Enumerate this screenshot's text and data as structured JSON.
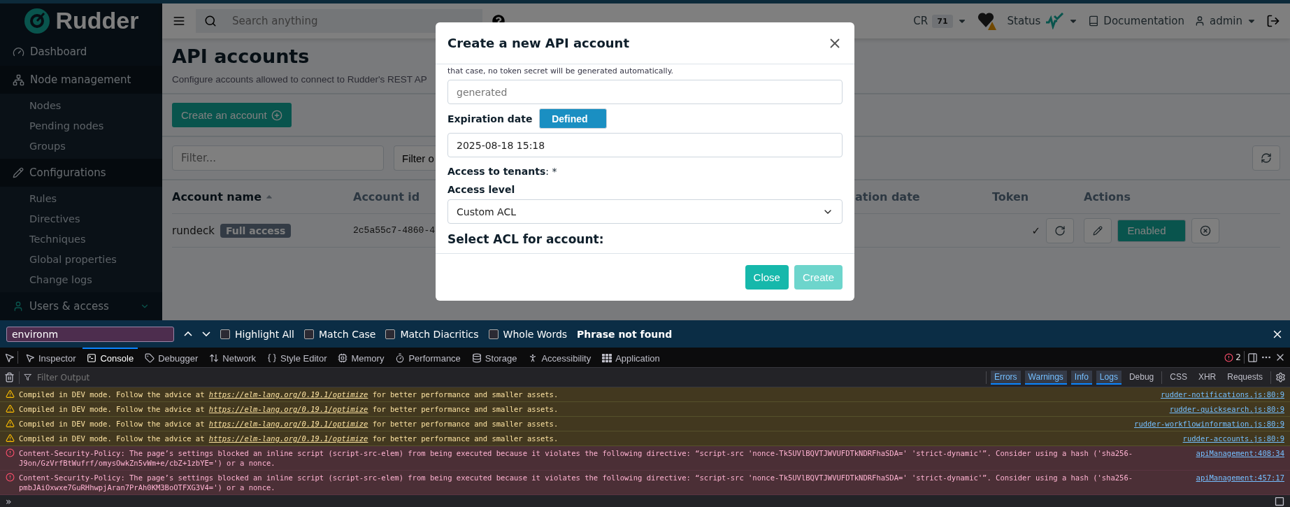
{
  "sidebar": {
    "logo": "Rudder",
    "items": [
      {
        "kind": "link",
        "label": "Dashboard"
      },
      {
        "kind": "section",
        "label": "Node management",
        "children": [
          {
            "label": "Nodes"
          },
          {
            "label": "Pending nodes"
          },
          {
            "label": "Groups"
          }
        ]
      },
      {
        "kind": "section",
        "label": "Configurations",
        "children": [
          {
            "label": "Rules"
          },
          {
            "label": "Directives"
          },
          {
            "label": "Techniques"
          },
          {
            "label": "Global properties"
          },
          {
            "label": "Change logs"
          }
        ]
      },
      {
        "kind": "collapsible",
        "label": "Users & access"
      }
    ]
  },
  "topbar": {
    "search": {
      "placeholder": "Search anything"
    },
    "cr_label": "CR",
    "cr_count": "71",
    "status": "Status",
    "documentation": "Documentation",
    "user": "admin"
  },
  "page": {
    "title": "API accounts",
    "description": "Configure accounts allowed to connect to Rudder's REST AP",
    "create_button": "Create an account",
    "filter": {
      "placeholder": "Filter..."
    },
    "filter_button": "Filter o",
    "table": {
      "columns": [
        {
          "label": "Account name",
          "sorted": true
        },
        {
          "label": "Account id",
          "sorted": false
        },
        {
          "label": "ation date",
          "sorted": false
        },
        {
          "label": "Token",
          "sorted": false
        },
        {
          "label": "Actions",
          "sorted": false
        }
      ],
      "rows": [
        {
          "name": "rundeck",
          "badge": "Full access",
          "id": "2c5a55c7-4860-4",
          "token": "✓",
          "enabled": true,
          "toggle_label": "Enabled"
        }
      ]
    }
  },
  "modal": {
    "title": "Create a new API account",
    "help": "that case, no token secret will be generated automatically.",
    "token_field": {
      "placeholder": "generated"
    },
    "expiration_label": "Expiration date",
    "expiration_toggle": {
      "label": "Defined",
      "on": true
    },
    "expiration_value": "2025-08-18 15:18",
    "tenants_label": "**Access to tenants**: *",
    "access_level_label": "Access level",
    "access_level_value": "Custom ACL",
    "acl_heading": "Select ACL for account:",
    "buttons": [
      {
        "label": "Close",
        "disabled": false
      },
      {
        "label": "Create",
        "disabled": true
      }
    ]
  },
  "findbar": {
    "value": "environm",
    "options": [
      {
        "label": "Highlight All",
        "checked": false
      },
      {
        "label": "Match Case",
        "checked": false
      },
      {
        "label": "Match Diacritics",
        "checked": false
      },
      {
        "label": "Whole Words",
        "checked": false
      }
    ],
    "status": "Phrase not found"
  },
  "devtools": {
    "tabs": [
      {
        "label": "Inspector",
        "selected": false
      },
      {
        "label": "Console",
        "selected": true
      },
      {
        "label": "Debugger",
        "selected": false
      },
      {
        "label": "Network",
        "selected": false
      },
      {
        "label": "Style Editor",
        "selected": false
      },
      {
        "label": "Memory",
        "selected": false
      },
      {
        "label": "Performance",
        "selected": false
      },
      {
        "label": "Storage",
        "selected": false
      },
      {
        "label": "Accessibility",
        "selected": false
      },
      {
        "label": "Application",
        "selected": false
      }
    ],
    "error_count": "2",
    "filter": {
      "placeholder": "Filter Output"
    },
    "levels": [
      {
        "label": "Errors",
        "selected": true
      },
      {
        "label": "Warnings",
        "selected": true
      },
      {
        "label": "Info",
        "selected": true
      },
      {
        "label": "Logs",
        "selected": true
      },
      {
        "label": "Debug",
        "selected": false
      }
    ],
    "types": [
      {
        "label": "CSS",
        "selected": false
      },
      {
        "label": "XHR",
        "selected": false
      },
      {
        "label": "Requests",
        "selected": false
      }
    ],
    "messages": [
      {
        "kind": "warning",
        "text": "Compiled in DEV mode. Follow the advice at",
        "link": "https://elm-lang.org/0.19.1/optimize",
        "text_after": "for better performance and smaller assets.",
        "source": "rudder-notifications.js:80:9"
      },
      {
        "kind": "warning",
        "text": "Compiled in DEV mode. Follow the advice at",
        "link": "https://elm-lang.org/0.19.1/optimize",
        "text_after": "for better performance and smaller assets.",
        "source": "rudder-quicksearch.js:80:9"
      },
      {
        "kind": "warning",
        "text": "Compiled in DEV mode. Follow the advice at",
        "link": "https://elm-lang.org/0.19.1/optimize",
        "text_after": "for better performance and smaller assets.",
        "source": "rudder-workflowinformation.js:80:9"
      },
      {
        "kind": "warning",
        "text": "Compiled in DEV mode. Follow the advice at",
        "link": "https://elm-lang.org/0.19.1/optimize",
        "text_after": "for better performance and smaller assets.",
        "source": "rudder-accounts.js:80:9"
      },
      {
        "kind": "error",
        "text": "Content-Security-Policy: The page’s settings blocked an inline script (script-src-elem) from being executed because it violates the following directive: “script-src 'nonce-Tk5UVlBQVTJWVUFDTkNDRFhaSDA=' 'strict-dynamic'”. Consider using a hash ('sha256-J9on/GzVrfBtWufrf/omysOwkZn5vWm+e/cbZ+1zbYE=') or a nonce.",
        "source": "apiManagement:408:34"
      },
      {
        "kind": "error",
        "text": "Content-Security-Policy: The page’s settings blocked an inline script (script-src-elem) from being executed because it violates the following directive: “script-src 'nonce-Tk5UVlBQVTJWVUFDTkNDRFhaSDA=' 'strict-dynamic'”. Consider using a hash ('sha256-pmbJAiOxwxe7GuRHhwpjAran7PrAh0KM3BoOTFXG3V4=') or a nonce.",
        "source": "apiManagement:457:17"
      }
    ],
    "prompt": "»"
  }
}
